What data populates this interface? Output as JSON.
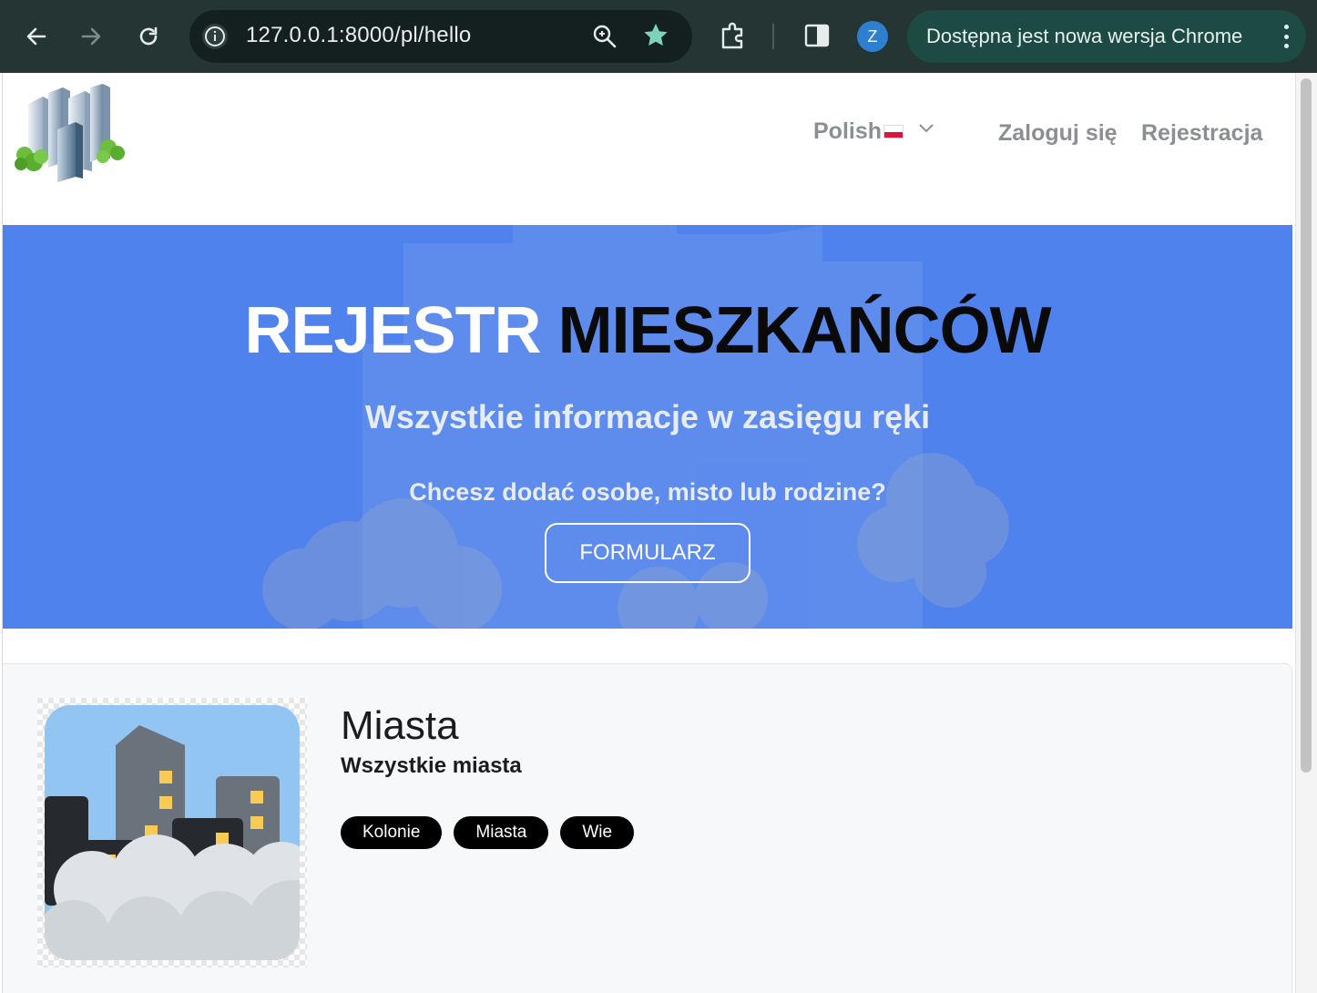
{
  "browser": {
    "url": "127.0.0.1:8000/pl/hello",
    "avatar_letter": "Z",
    "update_notice": "Dostępna jest nowa wersja Chrome",
    "icons": [
      "back-icon",
      "forward-icon",
      "reload-icon",
      "info-icon",
      "zoom-icon",
      "star-icon",
      "extensions-icon",
      "side-panel-icon",
      "kebab-menu-icon"
    ]
  },
  "navbar": {
    "language_label": "Polish",
    "login_label": "Zaloguj się",
    "register_label": "Rejestracja"
  },
  "hero": {
    "title_part1": "REJESTR",
    "title_part2": "MIESZKAŃCÓW",
    "subtitle": "Wszystkie informacje w zasięgu ręki",
    "question": "Chcesz dodać osobe, misto lub rodzine?",
    "button_label": "FORMULARZ",
    "background_color": "#4f82ec"
  },
  "card": {
    "title": "Miasta",
    "subtitle": "Wszystkie miasta",
    "tags": [
      "Kolonie",
      "Miasta",
      "Wie"
    ]
  }
}
